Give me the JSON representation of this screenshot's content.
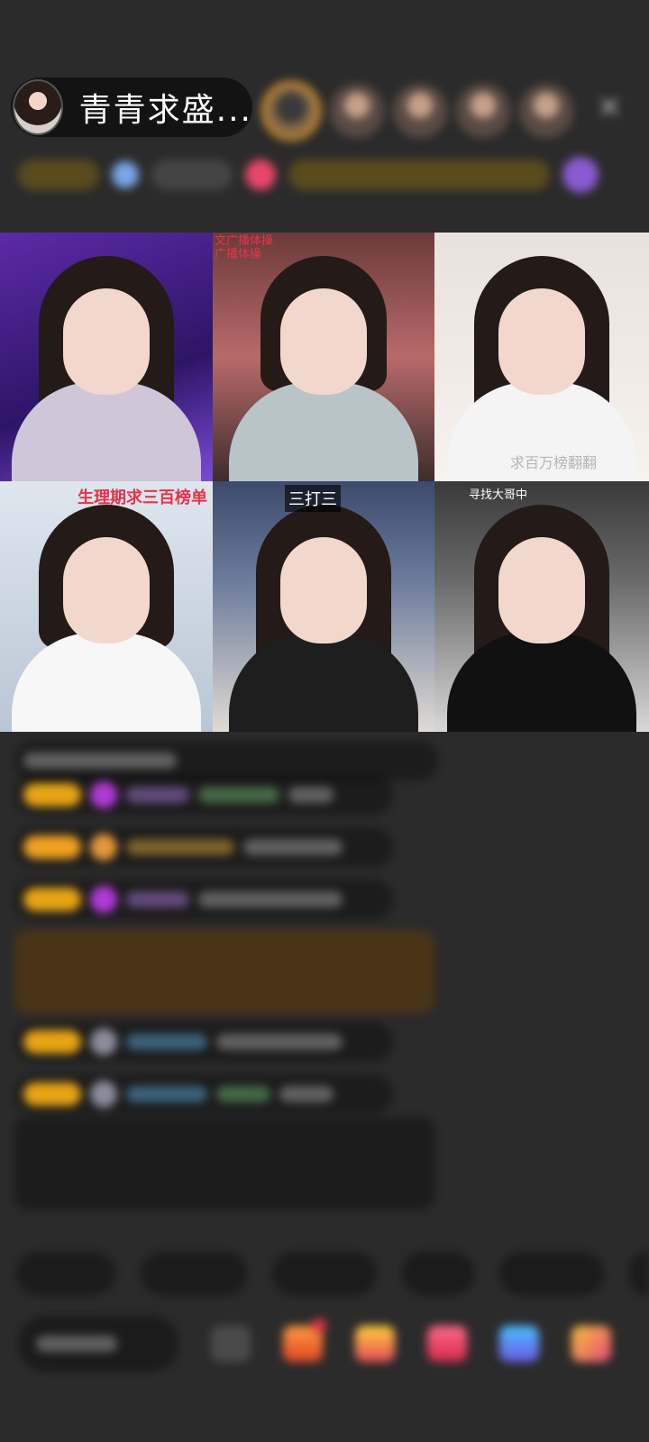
{
  "header": {
    "host_name": "青青求盛...",
    "close_label": "×"
  },
  "grid": {
    "tiles": [
      {
        "caption": ""
      },
      {
        "caption": "文广播体操\n广播体操"
      },
      {
        "caption": "求百万榜翻翻"
      },
      {
        "caption": "生理期求三百榜单"
      },
      {
        "caption": "三打三"
      },
      {
        "caption": "寻找大哥中"
      }
    ]
  },
  "colors": {
    "background": "#2b2b2b",
    "accent_gold": "#e8a415",
    "caption_red": "#e8334a"
  }
}
